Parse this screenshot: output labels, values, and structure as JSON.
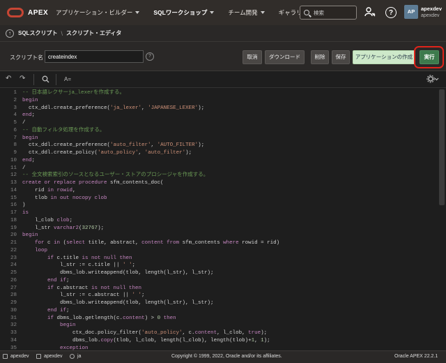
{
  "nav": {
    "logo_text": "APEX",
    "items": [
      {
        "label": "アプリケーション・ビルダー",
        "dropdown": true,
        "active": false
      },
      {
        "label": "SQLワークショップ",
        "dropdown": true,
        "active": true
      },
      {
        "label": "チーム開発",
        "dropdown": true,
        "active": false
      },
      {
        "label": "ギャラリ",
        "dropdown": false,
        "active": false
      }
    ],
    "search_placeholder": "検索",
    "user_initials": "AP",
    "user_name": "apexdev",
    "user_workspace": "apexdev"
  },
  "breadcrumb": {
    "items": [
      "SQLスクリプト",
      "スクリプト・エディタ"
    ]
  },
  "script": {
    "name_label": "スクリプト名",
    "name_value": "createindex",
    "help": "?",
    "buttons": {
      "cancel": "取消",
      "download": "ダウンロード",
      "delete": "削除",
      "save": "保存",
      "create_app": "アプリケーションの作成",
      "run": "実行"
    }
  },
  "editor_toolbar": {
    "font_label": "A="
  },
  "colors": {
    "comment": "#6a9955",
    "keyword": "#c586c0",
    "string": "#ce9178",
    "number": "#b5cea8",
    "plain": "#d4d4d4",
    "highlight": "#e0241b",
    "run_button": "#3d7a4d"
  },
  "code": [
    [
      [
        "c",
        "-- 日本語レクサーja_lexerを作成する。"
      ]
    ],
    [
      [
        "k",
        "begin"
      ]
    ],
    [
      [
        "p",
        "  ctx_ddl.create_preference("
      ],
      [
        "s",
        "'ja_lexer'"
      ],
      [
        "p",
        ", "
      ],
      [
        "s",
        "'JAPANESE_LEXER'"
      ],
      [
        "p",
        ");"
      ]
    ],
    [
      [
        "k",
        "end"
      ],
      [
        "p",
        ";"
      ]
    ],
    [
      [
        "p",
        "/"
      ]
    ],
    [
      [
        "c",
        "-- 自動フィルタ処理を作成する。"
      ]
    ],
    [
      [
        "k",
        "begin"
      ]
    ],
    [
      [
        "p",
        "  ctx_ddl.create_preference("
      ],
      [
        "s",
        "'auto_filter'"
      ],
      [
        "p",
        ", "
      ],
      [
        "s",
        "'AUTO_FILTER'"
      ],
      [
        "p",
        ");"
      ]
    ],
    [
      [
        "p",
        "  ctx_ddl.create_policy("
      ],
      [
        "s",
        "'auto_policy'"
      ],
      [
        "p",
        ", "
      ],
      [
        "s",
        "'auto_filter'"
      ],
      [
        "p",
        ");"
      ]
    ],
    [
      [
        "k",
        "end"
      ],
      [
        "p",
        ";"
      ]
    ],
    [
      [
        "p",
        "/"
      ]
    ],
    [
      [
        "c",
        "-- 全文検索索引のソースとなるユーザー・ストアのプロシージャを作成する。"
      ]
    ],
    [
      [
        "k",
        "create or replace procedure"
      ],
      [
        "p",
        " sfm_contents_doc("
      ]
    ],
    [
      [
        "p",
        "    rid "
      ],
      [
        "k",
        "in"
      ],
      [
        "k",
        " rowid"
      ],
      [
        "p",
        ","
      ]
    ],
    [
      [
        "p",
        "    tlob "
      ],
      [
        "k",
        "in out nocopy clob"
      ]
    ],
    [
      [
        "p",
        ")"
      ]
    ],
    [
      [
        "k",
        "is"
      ]
    ],
    [
      [
        "p",
        "    l_clob "
      ],
      [
        "k",
        "clob"
      ],
      [
        "p",
        ";"
      ]
    ],
    [
      [
        "p",
        "    l_str "
      ],
      [
        "k",
        "varchar2"
      ],
      [
        "p",
        "("
      ],
      [
        "n",
        "32767"
      ],
      [
        "p",
        ");"
      ]
    ],
    [
      [
        "k",
        "begin"
      ]
    ],
    [
      [
        "p",
        "    "
      ],
      [
        "k",
        "for"
      ],
      [
        "p",
        " c "
      ],
      [
        "k",
        "in"
      ],
      [
        "p",
        " ("
      ],
      [
        "k",
        "select"
      ],
      [
        "p",
        " title, abstract, "
      ],
      [
        "k",
        "content"
      ],
      [
        "k",
        " from"
      ],
      [
        "p",
        " sfm_contents "
      ],
      [
        "k",
        "where"
      ],
      [
        "p",
        " rowid = rid)"
      ]
    ],
    [
      [
        "p",
        "    "
      ],
      [
        "k",
        "loop"
      ]
    ],
    [
      [
        "p",
        "        "
      ],
      [
        "k",
        "if"
      ],
      [
        "p",
        " c.title "
      ],
      [
        "k",
        "is not null then"
      ]
    ],
    [
      [
        "p",
        "            l_str := c.title || "
      ],
      [
        "s",
        "' '"
      ],
      [
        "p",
        ";"
      ]
    ],
    [
      [
        "p",
        "            dbms_lob.writeappend(tlob, length(l_str), l_str);"
      ]
    ],
    [
      [
        "p",
        "        "
      ],
      [
        "k",
        "end if"
      ],
      [
        "p",
        ";"
      ]
    ],
    [
      [
        "p",
        "        "
      ],
      [
        "k",
        "if"
      ],
      [
        "p",
        " c.abstract "
      ],
      [
        "k",
        "is not null then"
      ]
    ],
    [
      [
        "p",
        "            l_str := c.abstract || "
      ],
      [
        "s",
        "' '"
      ],
      [
        "p",
        ";"
      ]
    ],
    [
      [
        "p",
        "            dbms_lob.writeappend(tlob, length(l_str), l_str);"
      ]
    ],
    [
      [
        "p",
        "        "
      ],
      [
        "k",
        "end if"
      ],
      [
        "p",
        ";"
      ]
    ],
    [
      [
        "p",
        "        "
      ],
      [
        "k",
        "if"
      ],
      [
        "p",
        " dbms_lob.getlength(c."
      ],
      [
        "k",
        "content"
      ],
      [
        "p",
        ") > "
      ],
      [
        "n",
        "0"
      ],
      [
        "k",
        " then"
      ]
    ],
    [
      [
        "p",
        "            "
      ],
      [
        "k",
        "begin"
      ]
    ],
    [
      [
        "p",
        "                ctx_doc.policy_filter("
      ],
      [
        "s",
        "'auto_policy'"
      ],
      [
        "p",
        ", c."
      ],
      [
        "k",
        "content"
      ],
      [
        "p",
        ", l_clob, "
      ],
      [
        "k",
        "true"
      ],
      [
        "p",
        ");"
      ]
    ],
    [
      [
        "p",
        "                dbms_lob."
      ],
      [
        "k",
        "copy"
      ],
      [
        "p",
        "(tlob, l_clob, length(l_clob), length(tlob)+"
      ],
      [
        "n",
        "1"
      ],
      [
        "p",
        ", "
      ],
      [
        "n",
        "1"
      ],
      [
        "p",
        ");"
      ]
    ],
    [
      [
        "p",
        "            "
      ],
      [
        "k",
        "exception"
      ]
    ]
  ],
  "footer": {
    "user": "apexdev",
    "workspace": "apexdev",
    "language": "ja",
    "copyright": "Copyright © 1999, 2022, Oracle and/or its affiliates.",
    "version": "Oracle APEX 22.2.1"
  }
}
